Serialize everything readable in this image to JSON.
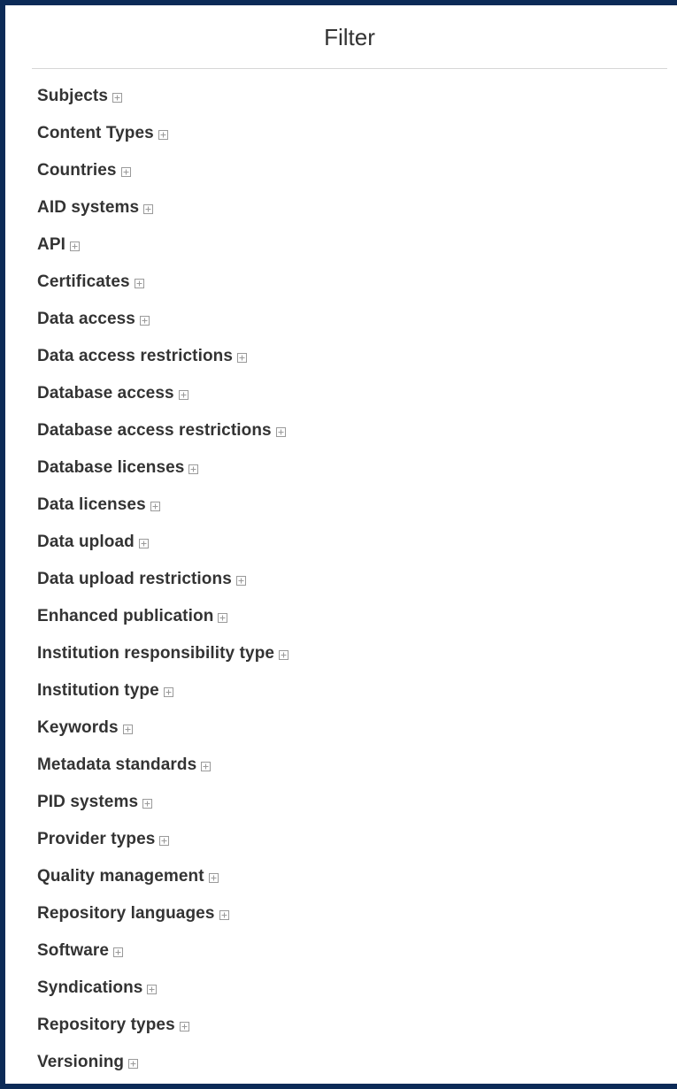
{
  "panel": {
    "title": "Filter"
  },
  "icons": {
    "expand": "plus-box-icon"
  },
  "colors": {
    "frame": "#0b2a57",
    "text": "#333333",
    "icon": "#9a9a9a"
  },
  "filters": [
    "Subjects",
    "Content Types",
    "Countries",
    "AID systems",
    "API",
    "Certificates",
    "Data access",
    "Data access restrictions",
    "Database access",
    "Database access restrictions",
    "Database licenses",
    "Data licenses",
    "Data upload",
    "Data upload restrictions",
    "Enhanced publication",
    "Institution responsibility type",
    "Institution type",
    "Keywords",
    "Metadata standards",
    "PID systems",
    "Provider types",
    "Quality management",
    "Repository languages",
    "Software",
    "Syndications",
    "Repository types",
    "Versioning"
  ]
}
